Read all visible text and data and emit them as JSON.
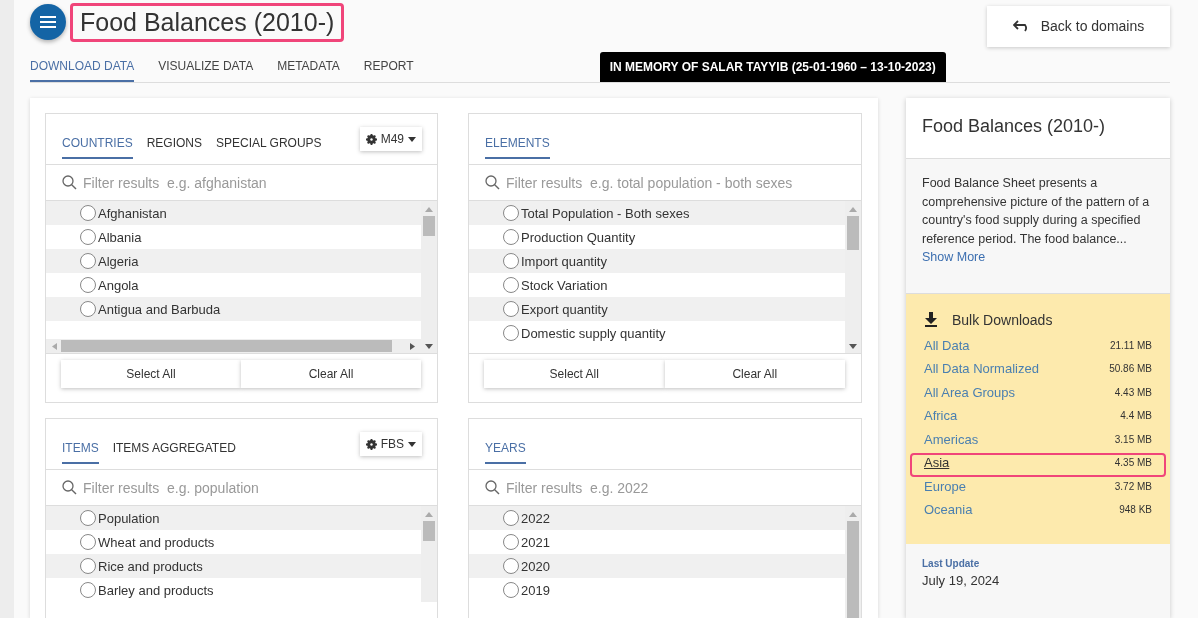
{
  "header": {
    "title": "Food Balances (2010-)",
    "title_highlighted": true,
    "back_button": "Back to domains"
  },
  "tabs": [
    {
      "label": "DOWNLOAD DATA",
      "selected": true
    },
    {
      "label": "VISUALIZE DATA",
      "selected": false
    },
    {
      "label": "METADATA",
      "selected": false
    },
    {
      "label": "REPORT",
      "selected": false
    }
  ],
  "banner": "IN MEMORY OF SALAR TAYYIB (25-01-1960 – 13-10-2023)",
  "panels": [
    {
      "tabs": [
        {
          "label": "COUNTRIES",
          "selected": true
        },
        {
          "label": "REGIONS",
          "selected": false
        },
        {
          "label": "SPECIAL GROUPS",
          "selected": false
        }
      ],
      "dropdown": "M49",
      "placeholder": "Filter results  e.g. afghanistan",
      "hscroll": true,
      "items": [
        {
          "label": "Afghanistan",
          "selected": false
        },
        {
          "label": "Albania",
          "selected": false
        },
        {
          "label": "Algeria",
          "selected": false
        },
        {
          "label": "Angola",
          "selected": false
        },
        {
          "label": "Antigua and Barbuda",
          "selected": false
        }
      ],
      "buttons": [
        "Select All",
        "Clear All"
      ]
    },
    {
      "tabs": [
        {
          "label": "ELEMENTS",
          "selected": true
        }
      ],
      "placeholder": "Filter results  e.g. total population - both sexes",
      "hscroll": false,
      "items": [
        {
          "label": "Total Population - Both sexes",
          "selected": false
        },
        {
          "label": "Production Quantity",
          "selected": false
        },
        {
          "label": "Import quantity",
          "selected": false
        },
        {
          "label": "Stock Variation",
          "selected": false
        },
        {
          "label": "Export quantity",
          "selected": false
        },
        {
          "label": "Domestic supply quantity",
          "selected": false
        }
      ],
      "buttons": [
        "Select All",
        "Clear All"
      ]
    },
    {
      "tabs": [
        {
          "label": "ITEMS",
          "selected": true
        },
        {
          "label": "ITEMS AGGREGATED",
          "selected": false
        }
      ],
      "dropdown": "FBS",
      "placeholder": "Filter results  e.g. population",
      "hscroll": false,
      "items": [
        {
          "label": "Population",
          "selected": false
        },
        {
          "label": "Wheat and products",
          "selected": false
        },
        {
          "label": "Rice and products",
          "selected": false
        },
        {
          "label": "Barley and products",
          "selected": false
        }
      ]
    },
    {
      "tabs": [
        {
          "label": "YEARS",
          "selected": true
        }
      ],
      "placeholder": "Filter results  e.g. 2022",
      "hscroll": false,
      "items": [
        {
          "label": "2022",
          "selected": false
        },
        {
          "label": "2021",
          "selected": false
        },
        {
          "label": "2020",
          "selected": false
        },
        {
          "label": "2019",
          "selected": false
        }
      ]
    }
  ],
  "sidebar": {
    "title": "Food Balances (2010-)",
    "description": "Food Balance Sheet presents a comprehensive picture of the pattern of a country's food supply during a specified reference period. The food balance...",
    "show_more": "Show More",
    "bulk_title": "Bulk Downloads",
    "downloads": [
      {
        "label": "All Data",
        "size": "21.11 MB",
        "highlighted": false
      },
      {
        "label": "All Data Normalized",
        "size": "50.86 MB",
        "highlighted": false
      },
      {
        "label": "All Area Groups",
        "size": "4.43 MB",
        "highlighted": false
      },
      {
        "label": "Africa",
        "size": "4.4 MB",
        "highlighted": false
      },
      {
        "label": "Americas",
        "size": "3.15 MB",
        "highlighted": false
      },
      {
        "label": "Asia",
        "size": "4.35 MB",
        "highlighted": true
      },
      {
        "label": "Europe",
        "size": "3.72 MB",
        "highlighted": false
      },
      {
        "label": "Oceania",
        "size": "948 KB",
        "highlighted": false
      }
    ],
    "last_update_label": "Last Update",
    "last_update": "July 19, 2024"
  }
}
